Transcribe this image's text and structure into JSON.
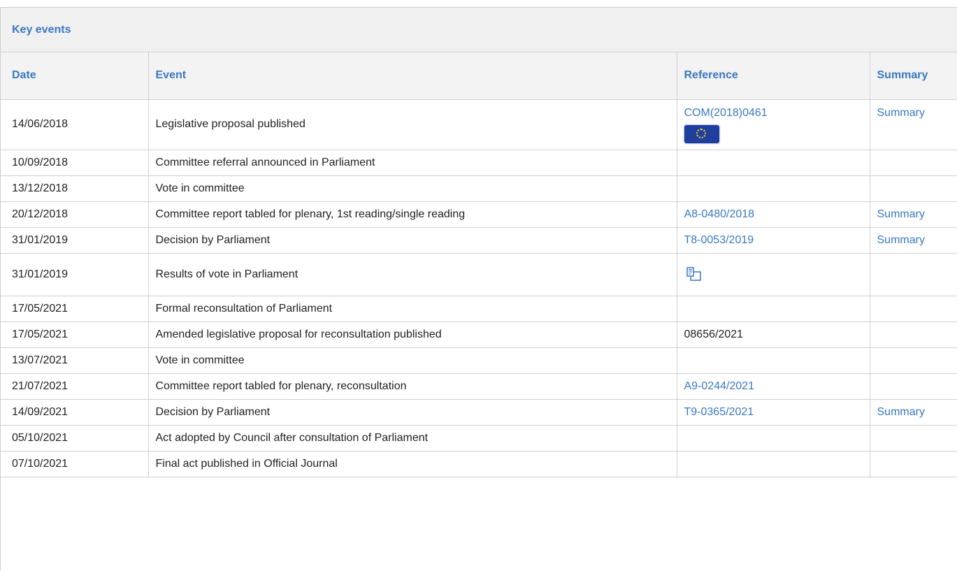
{
  "panel": {
    "title": "Key events"
  },
  "columns": {
    "date": "Date",
    "event": "Event",
    "reference": "Reference",
    "summary": "Summary"
  },
  "rows": [
    {
      "date": "14/06/2018",
      "event": "Legislative proposal published",
      "reference": "COM(2018)0461",
      "reference_icon": "eu-flag-icon",
      "summary": "Summary"
    },
    {
      "date": "10/09/2018",
      "event": "Committee referral announced in Parliament"
    },
    {
      "date": "13/12/2018",
      "event": "Vote in committee"
    },
    {
      "date": "20/12/2018",
      "event": "Committee report tabled for plenary, 1st reading/single reading",
      "reference": "A8-0480/2018",
      "summary": "Summary"
    },
    {
      "date": "31/01/2019",
      "event": "Decision by Parliament",
      "reference": "T8-0053/2019",
      "summary": "Summary"
    },
    {
      "date": "31/01/2019",
      "event": "Results of vote in Parliament",
      "reference_icon": "vote-results-icon"
    },
    {
      "date": "17/05/2021",
      "event": "Formal reconsultation of Parliament"
    },
    {
      "date": "17/05/2021",
      "event": "Amended legislative proposal for reconsultation published",
      "reference": "08656/2021"
    },
    {
      "date": "13/07/2021",
      "event": "Vote in committee"
    },
    {
      "date": "21/07/2021",
      "event": "Committee report tabled for plenary, reconsultation",
      "reference": "A9-0244/2021"
    },
    {
      "date": "14/09/2021",
      "event": "Decision by Parliament",
      "reference": "T9-0365/2021",
      "summary": "Summary"
    },
    {
      "date": "05/10/2021",
      "event": "Act adopted by Council after consultation of Parliament"
    },
    {
      "date": "07/10/2021",
      "event": "Final act published in Official Journal"
    }
  ],
  "colors": {
    "link": "#3a78c3",
    "header_bg": "#f0f0f0",
    "border": "#cfcfcf"
  }
}
